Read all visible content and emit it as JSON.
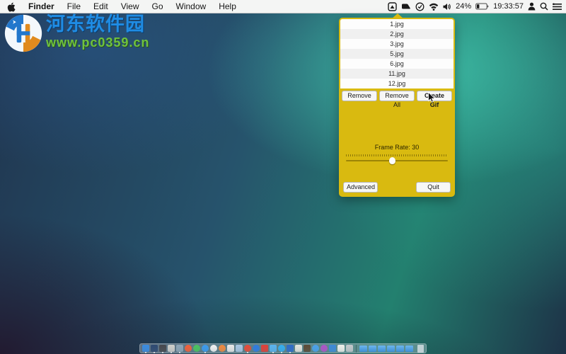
{
  "menu_bar": {
    "app_name": "Finder",
    "menus": [
      "Finder",
      "File",
      "Edit",
      "View",
      "Go",
      "Window",
      "Help"
    ],
    "battery_percent": "24%",
    "clock": "19:33:57",
    "status_icons": [
      "gif-app-icon",
      "camera-icon",
      "check-circle-icon",
      "wifi-icon",
      "volume-icon",
      "battery-icon",
      "user-icon",
      "search-icon",
      "notification-list-icon"
    ]
  },
  "watermark": {
    "site_name": "河东软件园",
    "site_url": "www.pc0359.cn"
  },
  "popover": {
    "accent_color": "#d9ba10",
    "files": [
      "1.jpg",
      "2.jpg",
      "3.jpg",
      "5.jpg",
      "6.jpg",
      "11.jpg",
      "12.jpg"
    ],
    "remove_label": "Remove",
    "remove_all_label": "Remove All",
    "create_gif_label": "Create Gif",
    "frame_rate_label": "Frame Rate: 30",
    "frame_rate_value": 30,
    "slider_percent": 45,
    "advanced_label": "Advanced",
    "quit_label": "Quit"
  },
  "dock": {
    "apps": [
      {
        "name": "finder",
        "color": "#3a8ce0",
        "shape": "square",
        "dot": true
      },
      {
        "name": "photos-dark-app",
        "color": "#2e4a72",
        "shape": "square",
        "dot": true
      },
      {
        "name": "dark-gray-app",
        "color": "#47484d",
        "shape": "square",
        "dot": true
      },
      {
        "name": "light-gray-app",
        "color": "#cfcfcb",
        "shape": "square",
        "dot": true
      },
      {
        "name": "mail-app",
        "color": "#8ea6b8",
        "shape": "square",
        "dot": true
      },
      {
        "name": "orange-circle-app",
        "color": "#f2603a",
        "shape": "circle",
        "dot": false
      },
      {
        "name": "green-circle-app",
        "color": "#49c45e",
        "shape": "circle",
        "dot": false
      },
      {
        "name": "safari",
        "color": "#3b9bee",
        "shape": "circle",
        "dot": true
      },
      {
        "name": "photos-app",
        "color": "#f2f2f2",
        "shape": "circle",
        "dot": false
      },
      {
        "name": "itunes-app",
        "color": "#f08a3e",
        "shape": "circle",
        "dot": false
      },
      {
        "name": "white-app",
        "color": "#e9e9e9",
        "shape": "square",
        "dot": false
      },
      {
        "name": "small-blue-app",
        "color": "#aac8e4",
        "shape": "square",
        "dot": false
      },
      {
        "name": "chrome",
        "color": "#e74b39",
        "shape": "circle",
        "dot": true
      },
      {
        "name": "blue-globe-app",
        "color": "#2e7ce0",
        "shape": "circle",
        "dot": false
      },
      {
        "name": "red-app",
        "color": "#e04038",
        "shape": "square",
        "dot": false
      },
      {
        "name": "twitter-app",
        "color": "#5ab4f0",
        "shape": "square",
        "dot": true
      },
      {
        "name": "skype",
        "color": "#35aef0",
        "shape": "circle",
        "dot": true
      },
      {
        "name": "blue-square-app",
        "color": "#2f6cc8",
        "shape": "square",
        "dot": true
      },
      {
        "name": "notes-app",
        "color": "#e6e6de",
        "shape": "square",
        "dot": false
      },
      {
        "name": "dark-brown-app",
        "color": "#5c4a36",
        "shape": "square",
        "dot": false
      },
      {
        "name": "blue-gem-app",
        "color": "#4aa2ec",
        "shape": "circle",
        "dot": false
      },
      {
        "name": "purple-circle-app",
        "color": "#ae54c8",
        "shape": "circle",
        "dot": false
      },
      {
        "name": "blue-pencil-app",
        "color": "#3e8ad8",
        "shape": "square",
        "dot": false
      },
      {
        "name": "calendar-app",
        "color": "#eeeeea",
        "shape": "square",
        "dot": false
      },
      {
        "name": "gray-tool-app",
        "color": "#c4c8cc",
        "shape": "square",
        "dot": false
      }
    ],
    "folder_count": 6
  }
}
